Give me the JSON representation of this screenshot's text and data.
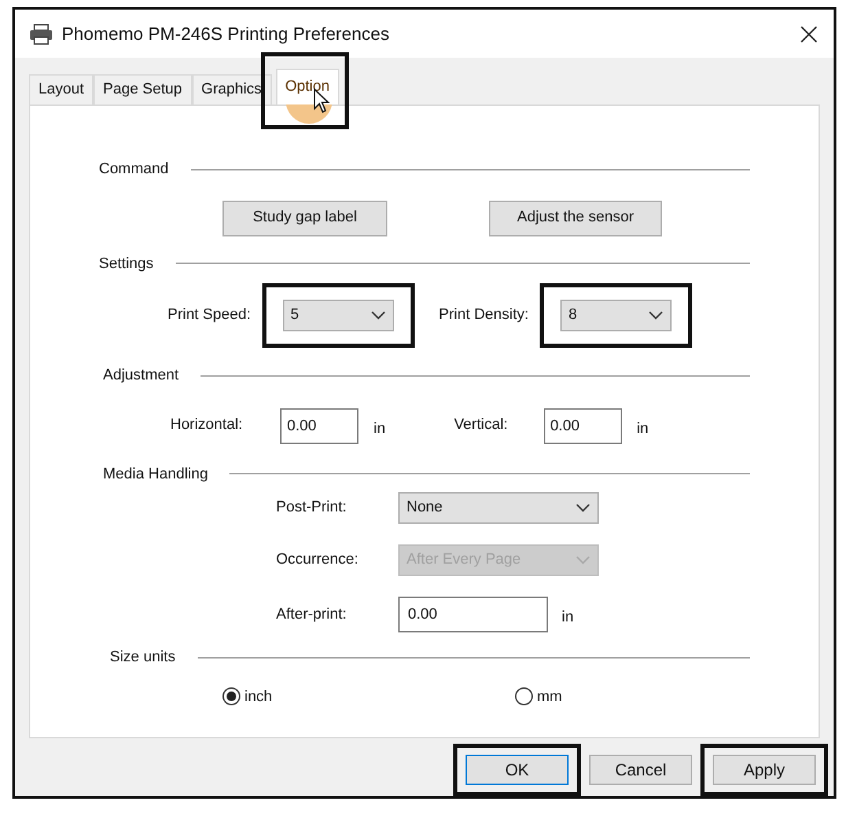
{
  "window": {
    "title": "Phomemo PM-246S Printing Preferences"
  },
  "tabs": [
    {
      "label": "Layout",
      "selected": false
    },
    {
      "label": "Page Setup",
      "selected": false
    },
    {
      "label": "Graphics",
      "selected": false
    },
    {
      "label": "Option",
      "selected": true,
      "highlighted": true,
      "clicked": true
    }
  ],
  "command": {
    "heading": "Command",
    "buttons": [
      {
        "label": "Study gap label"
      },
      {
        "label": "Adjust the sensor"
      }
    ]
  },
  "settings": {
    "heading": "Settings",
    "fields": [
      {
        "label": "Print Speed:",
        "value": "5",
        "highlighted": true
      },
      {
        "label": "Print Density:",
        "value": "8",
        "highlighted": true
      }
    ]
  },
  "adjustment": {
    "heading": "Adjustment",
    "fields": [
      {
        "label": "Horizontal:",
        "value": "0.00",
        "unit": "in"
      },
      {
        "label": "Vertical:",
        "value": "0.00",
        "unit": "in"
      }
    ]
  },
  "media_handling": {
    "heading": "Media Handling",
    "rows": [
      {
        "kind": "dropdown",
        "label": "Post-Print:",
        "value": "None",
        "disabled": false
      },
      {
        "kind": "dropdown",
        "label": "Occurrence:",
        "value": "After Every Page",
        "disabled": true
      },
      {
        "kind": "input",
        "label": "After-print:",
        "value": "0.00",
        "unit": "in"
      }
    ]
  },
  "size_units": {
    "heading": "Size units",
    "options": [
      {
        "label": "inch",
        "selected": true
      },
      {
        "label": "mm",
        "selected": false
      }
    ]
  },
  "buttons": [
    {
      "label": "OK",
      "default": true,
      "highlighted": true
    },
    {
      "label": "Cancel",
      "default": false,
      "highlighted": false
    },
    {
      "label": "Apply",
      "default": false,
      "highlighted": true
    }
  ]
}
